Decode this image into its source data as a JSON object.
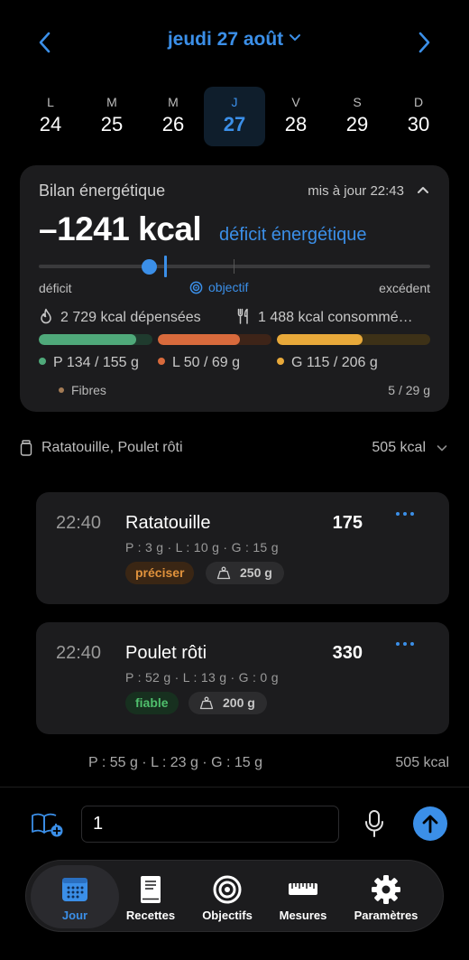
{
  "header": {
    "date_title": "jeudi 27 août"
  },
  "week": [
    {
      "letter": "L",
      "day": "24"
    },
    {
      "letter": "M",
      "day": "25"
    },
    {
      "letter": "M",
      "day": "26"
    },
    {
      "letter": "J",
      "day": "27",
      "selected": true
    },
    {
      "letter": "V",
      "day": "28"
    },
    {
      "letter": "S",
      "day": "29"
    },
    {
      "letter": "D",
      "day": "30"
    }
  ],
  "energy": {
    "title": "Bilan énergétique",
    "updated": "mis à jour 22:43",
    "balance": "–1241 kcal",
    "status": "déficit énergétique",
    "label_left": "déficit",
    "label_mid": "objectif",
    "label_right": "excédent",
    "burned": "2 729 kcal dépensées",
    "consumed": "1 488 kcal consommé…",
    "macros": [
      {
        "text": "P 134 / 155 g",
        "color": "#4fa97a",
        "fill": 0.86
      },
      {
        "text": "L 50 / 69 g",
        "color": "#d86a3c",
        "fill": 0.72
      },
      {
        "text": "G 115 / 206 g",
        "color": "#e8a93a",
        "fill": 0.56
      }
    ],
    "fibres_label": "Fibres",
    "fibres_value": "5 / 29 g",
    "fibres_color": "#a37b55"
  },
  "meal": {
    "name": "Ratatouille, Poulet rôti",
    "total": "505 kcal",
    "items": [
      {
        "time": "22:40",
        "name": "Ratatouille",
        "kcal": "175",
        "macros": "P : 3 g · L : 10 g · G : 15 g",
        "tag": "préciser",
        "weight": "250 g"
      },
      {
        "time": "22:40",
        "name": "Poulet rôti",
        "kcal": "330",
        "macros": "P : 52 g · L : 13 g · G : 0 g",
        "tag": "fiable",
        "weight": "200 g"
      }
    ],
    "summary": "P : 55 g · L : 23 g · G : 15 g",
    "summary_kcal": "505 kcal"
  },
  "composer": {
    "value": "1"
  },
  "tabs": [
    {
      "label": "Jour",
      "icon": "calendar-icon"
    },
    {
      "label": "Recettes",
      "icon": "book-icon"
    },
    {
      "label": "Objectifs",
      "icon": "target-icon"
    },
    {
      "label": "Mesures",
      "icon": "ruler-icon"
    },
    {
      "label": "Paramètres",
      "icon": "gear-icon"
    }
  ],
  "colors": {
    "accent": "#3b8fe8",
    "background": "#000000",
    "card": "#1c1c1e"
  }
}
